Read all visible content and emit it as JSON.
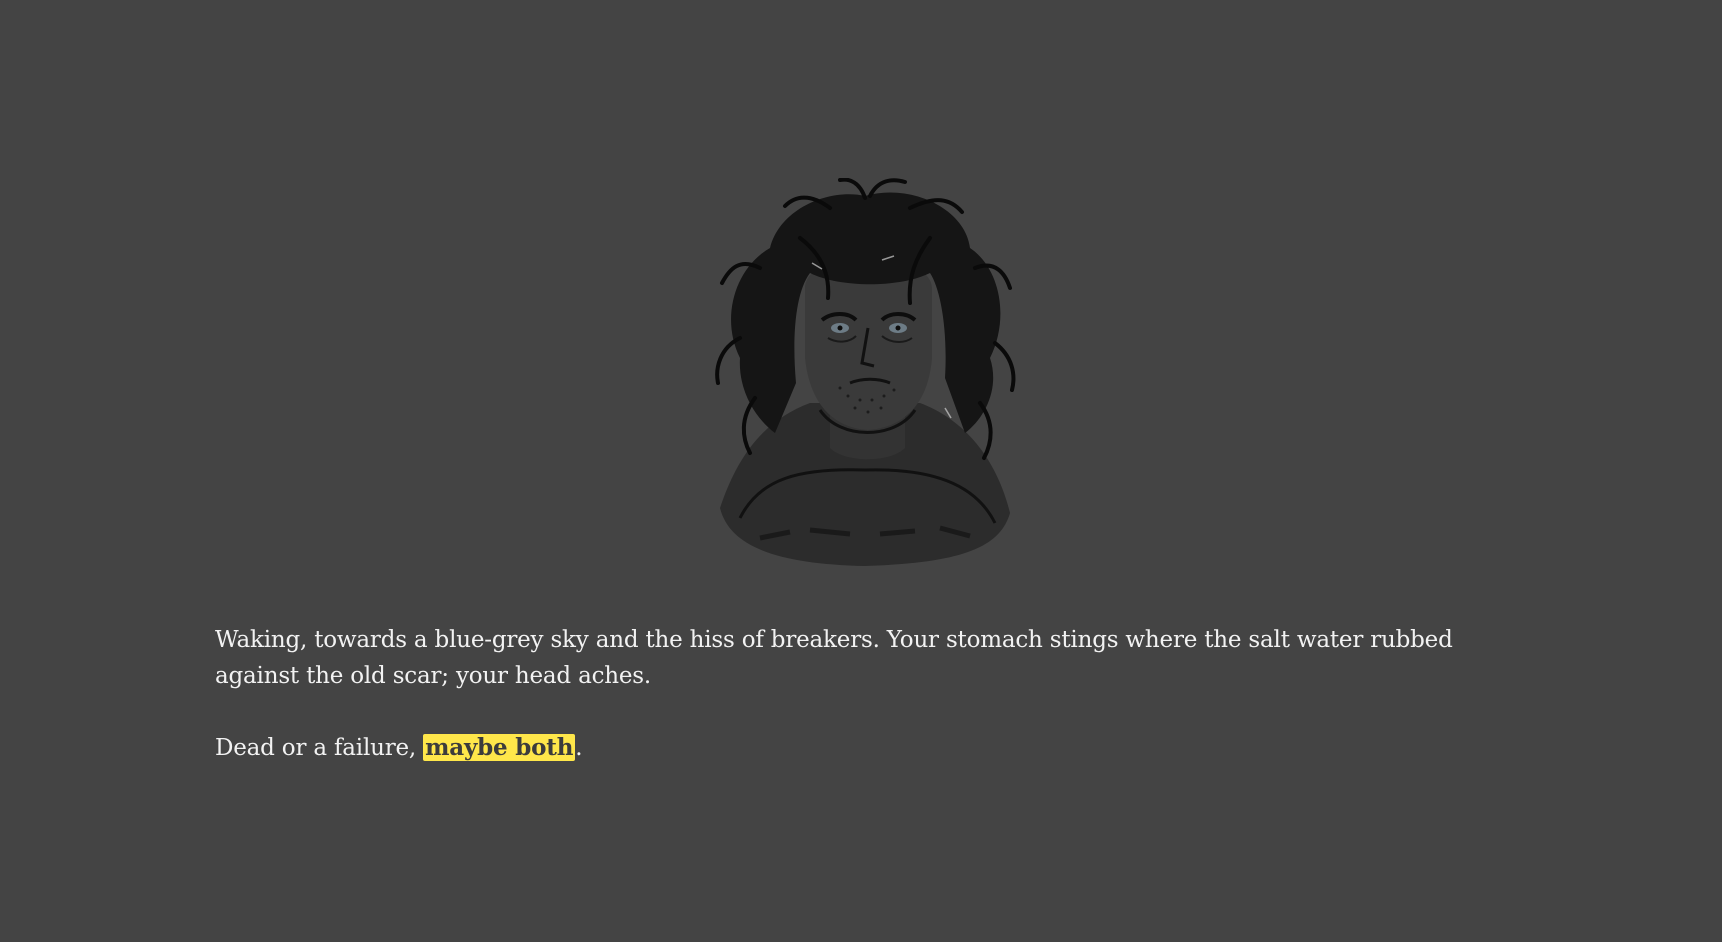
{
  "colors": {
    "background": "#444444",
    "text": "#f2f2f2",
    "highlight": "#ffe74a",
    "highlight_text": "#3c3c3c"
  },
  "illustration": {
    "icon": "character-portrait"
  },
  "story": {
    "paragraph1": "Waking, towards a blue-grey sky and the hiss of breakers. Your stomach stings where the salt water rubbed against the old scar; your head aches.",
    "paragraph2_prefix": "Dead or a failure, ",
    "paragraph2_link": "maybe both",
    "paragraph2_suffix": "."
  }
}
